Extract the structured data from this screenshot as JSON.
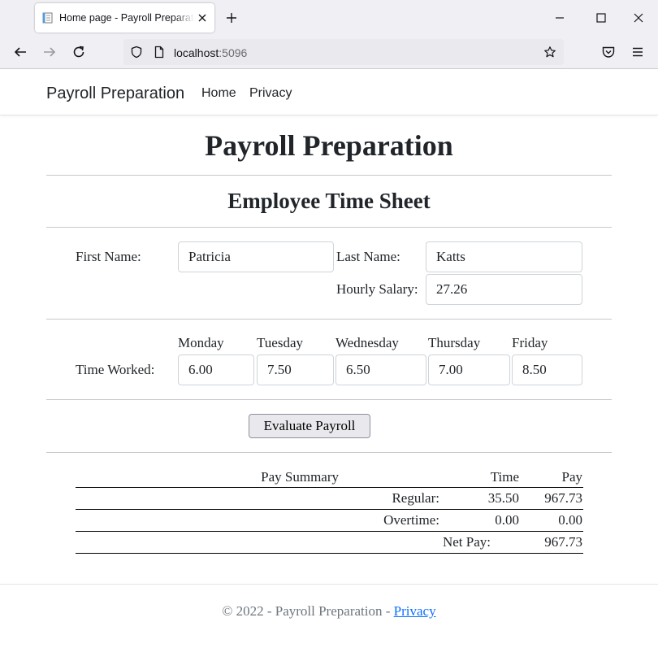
{
  "browser": {
    "tab_title": "Home page - Payroll Preparation",
    "url_host": "localhost",
    "url_port": ":5096"
  },
  "navbar": {
    "brand": "Payroll Preparation",
    "links": [
      "Home",
      "Privacy"
    ]
  },
  "page": {
    "title": "Payroll Preparation",
    "subtitle": "Employee Time Sheet"
  },
  "employee": {
    "first_name_label": "First Name:",
    "first_name": "Patricia",
    "last_name_label": "Last Name:",
    "last_name": "Katts",
    "hourly_salary_label": "Hourly Salary:",
    "hourly_salary": "27.26"
  },
  "time_worked": {
    "label": "Time Worked:",
    "days": [
      {
        "day": "Monday",
        "hours": "6.00"
      },
      {
        "day": "Tuesday",
        "hours": "7.50"
      },
      {
        "day": "Wednesday",
        "hours": "6.50"
      },
      {
        "day": "Thursday",
        "hours": "7.00"
      },
      {
        "day": "Friday",
        "hours": "8.50"
      }
    ]
  },
  "evaluate_button": "Evaluate Payroll",
  "summary": {
    "header": {
      "title": "Pay Summary",
      "time": "Time",
      "pay": "Pay"
    },
    "regular": {
      "label": "Regular:",
      "time": "35.50",
      "pay": "967.73"
    },
    "overtime": {
      "label": "Overtime:",
      "time": "0.00",
      "pay": "0.00"
    },
    "net": {
      "label": "Net Pay:",
      "pay": "967.73"
    }
  },
  "footer": {
    "text": "© 2022 - Payroll Preparation - ",
    "link": "Privacy"
  },
  "colors": {
    "link": "#0d6efd",
    "chrome_bg": "#f0f0f4",
    "muted_text": "#6c757d"
  },
  "icons": [
    "page-icon",
    "close-icon",
    "plus-icon",
    "minimize-icon",
    "maximize-icon",
    "close-window-icon",
    "back-arrow-icon",
    "forward-arrow-icon",
    "reload-icon",
    "shield-icon",
    "page-info-icon",
    "star-icon",
    "pocket-icon",
    "menu-icon"
  ]
}
